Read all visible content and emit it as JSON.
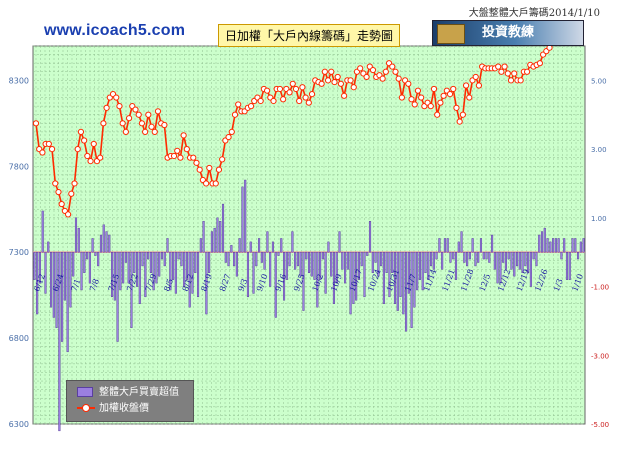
{
  "header": {
    "site": "www.icoach5.com",
    "chart_title": "日加權「大戶內線籌碼」走勢圖",
    "top_right": "大盤整體大戶籌碼2014/1/10",
    "badge_label": "投資教練"
  },
  "legend": {
    "bar_label": "整體大戶買賣超值",
    "line_label": "加權收盤價"
  },
  "colors": {
    "plot_bg": "#ccffcc",
    "grid": "#8fbf8f",
    "bar_fill": "#9b7fe0",
    "bar_stroke": "#4a2f90",
    "line": "#ff2a00",
    "marker_fill": "#ffffff",
    "zero_line": "#e8a0a0"
  },
  "chart_data": {
    "type": "bar+line",
    "title": "日加權「大戶內線籌碼」走勢圖",
    "y_left": {
      "ticks": [
        6300,
        6800,
        7300,
        7800,
        8300
      ],
      "range": [
        6300,
        8500
      ]
    },
    "y_right": {
      "ticks": [
        "-5.00",
        "-3.00",
        "-3.00",
        "-1.00",
        "1.00",
        "3.00",
        "5.00"
      ],
      "tick_values": [
        -5,
        -4,
        -3,
        -2,
        -1,
        0,
        1,
        2,
        3,
        4,
        5,
        6
      ],
      "range": [
        -5,
        6
      ]
    },
    "x_ticks": [
      "6/12",
      "6/24",
      "7/1",
      "7/8",
      "7/15",
      "7/22",
      "7/29",
      "8/5",
      "8/12",
      "8/19",
      "8/27",
      "9/3",
      "9/10",
      "9/16",
      "9/25",
      "10/2",
      "10/9",
      "10/17",
      "10/24",
      "10/31",
      "11/7",
      "11/14",
      "11/21",
      "11/28",
      "12/5",
      "12/12",
      "12/19",
      "12/26",
      "1/3",
      "1/10"
    ],
    "series": [
      {
        "name": "加權收盤價",
        "kind": "line",
        "axis": "left",
        "values": [
          8050,
          7900,
          7880,
          7930,
          7930,
          7900,
          7700,
          7650,
          7580,
          7540,
          7520,
          7640,
          7700,
          7900,
          8000,
          7950,
          7860,
          7830,
          7930,
          7830,
          7850,
          8050,
          8140,
          8200,
          8220,
          8200,
          8150,
          8050,
          8000,
          8080,
          8150,
          8130,
          8100,
          8050,
          8000,
          8100,
          8030,
          8000,
          8120,
          8050,
          8040,
          7850,
          7860,
          7860,
          7890,
          7850,
          7980,
          7900,
          7850,
          7850,
          7820,
          7780,
          7720,
          7700,
          7790,
          7700,
          7700,
          7780,
          7840,
          7950,
          7970,
          8000,
          8100,
          8160,
          8120,
          8120,
          8140,
          8150,
          8180,
          8200,
          8180,
          8250,
          8240,
          8200,
          8180,
          8250,
          8250,
          8190,
          8250,
          8230,
          8280,
          8250,
          8180,
          8260,
          8200,
          8170,
          8220,
          8300,
          8290,
          8280,
          8350,
          8300,
          8350,
          8290,
          8320,
          8280,
          8210,
          8300,
          8300,
          8260,
          8350,
          8370,
          8340,
          8320,
          8380,
          8360,
          8320,
          8330,
          8310,
          8350,
          8400,
          8380,
          8350,
          8310,
          8200,
          8300,
          8280,
          8190,
          8160,
          8240,
          8200,
          8150,
          8170,
          8150,
          8250,
          8100,
          8170,
          8210,
          8240,
          8220,
          8250,
          8140,
          8060,
          8100,
          8270,
          8200,
          8300,
          8320,
          8270,
          8380,
          8370,
          8370,
          8370,
          8370,
          8380,
          8350,
          8380,
          8340,
          8300,
          8340,
          8300,
          8300,
          8350,
          8350,
          8390,
          8380,
          8390,
          8400,
          8450,
          8470,
          8490,
          8530,
          8520,
          8560,
          8530,
          8600,
          8570,
          8620
        ]
      },
      {
        "name": "整體大戶買賣超值",
        "kind": "bar",
        "axis": "right",
        "values": [
          -0.8,
          -1.8,
          -0.9,
          1.2,
          -1.2,
          0.3,
          -1.6,
          -1.9,
          -2.2,
          -5.2,
          -2.6,
          -1.4,
          -2.9,
          -1.6,
          -0.7,
          1.0,
          0.7,
          -1.1,
          -0.6,
          -0.2,
          -0.9,
          0.4,
          -0.1,
          -0.4,
          0.5,
          0.8,
          0.6,
          0.5,
          -1.3,
          -1.4,
          -2.6,
          -1.1,
          -0.9,
          -0.3,
          -0.9,
          -2.2,
          -0.6,
          -1.0,
          -1.5,
          -0.4,
          -1.3,
          -0.2,
          -0.6,
          -1.1,
          -0.9,
          -0.7,
          -0.2,
          -0.4,
          0.4,
          -1.1,
          -0.8,
          -1.2,
          -0.2,
          -0.4,
          -1.0,
          -0.8,
          -1.6,
          -1.2,
          -0.6,
          -1.3,
          0.4,
          0.9,
          -1.8,
          -0.6,
          0.6,
          0.7,
          1.0,
          0.9,
          1.4,
          -0.3,
          -0.4,
          0.2,
          -0.4,
          -0.7,
          0.4,
          1.9,
          2.1,
          -1.3,
          0.3,
          -1.2,
          -0.4,
          0.4,
          -0.3,
          -0.5,
          0.6,
          -1.0,
          0.3,
          -1.9,
          -0.1,
          0.4,
          -1.4,
          -0.8,
          -0.4,
          0.6,
          -0.5,
          -0.4,
          -0.7,
          -1.7,
          -0.2,
          -0.6,
          -0.7,
          -0.8,
          -1.6,
          -0.8,
          -0.2,
          -1.2,
          0.3,
          -0.7,
          -1.5,
          -0.9,
          0.6,
          -0.5,
          -0.9,
          -0.5,
          -1.8,
          -1.5,
          -1.4,
          -0.8,
          -0.4,
          -1.3,
          -0.1,
          0.9,
          -0.6,
          -0.3,
          -0.7,
          -0.4,
          -1.5,
          -0.6,
          -1.3,
          -0.6,
          -1.5,
          -1.7,
          -1.3,
          -1.8,
          -2.3,
          -1.2,
          -2.2,
          -1.6,
          -1.1,
          -0.8,
          -1.1,
          -0.6,
          -0.8,
          -0.4,
          -0.5,
          -0.2,
          0.4,
          -0.5,
          0.4,
          0.4,
          -0.3,
          -0.2,
          -0.8,
          0.3,
          0.6,
          -0.3,
          -0.4,
          -0.2,
          0.4,
          -0.4,
          -0.3,
          0.4,
          -0.2,
          -0.2,
          -0.3,
          0.5,
          -0.5,
          -0.9,
          -0.9,
          -0.3,
          -0.5,
          -0.2,
          -0.5,
          -0.7,
          -0.4,
          -0.5,
          -0.6,
          -0.4,
          -0.6,
          -1.0,
          -0.2,
          -0.4,
          0.5,
          0.6,
          0.7,
          0.4,
          0.3,
          0.4,
          0.4,
          0.4,
          -0.2,
          0.4,
          -0.8,
          -0.8,
          0.4,
          0.4,
          -0.2,
          0.3,
          0.4
        ]
      }
    ],
    "grid": true,
    "legend_position": "bottom-left"
  }
}
